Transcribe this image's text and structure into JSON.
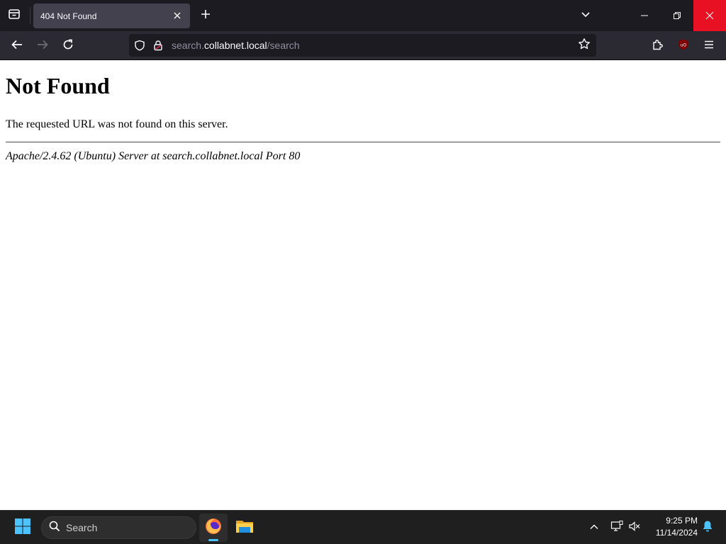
{
  "browser": {
    "tab": {
      "title": "404 Not Found"
    },
    "url": {
      "prefix": "search.",
      "host": "collabnet.local",
      "path": "/search"
    },
    "icons": {
      "tab_list": "firefox-view-icon",
      "close_tab": "close-icon",
      "new_tab": "plus-icon",
      "list_tabs": "chevron-down-icon",
      "back": "back-arrow-icon",
      "forward": "forward-arrow-icon",
      "reload": "reload-icon",
      "tracking": "shield-icon",
      "lock": "lock-icon",
      "bookmark": "star-icon",
      "extensions": "puzzle-icon",
      "ublock": "ublock-origin-icon",
      "menu": "hamburger-menu-icon"
    },
    "colors": {
      "chrome_dark": "#1c1b22",
      "toolbar": "#2b2a33",
      "tab_active": "#42414d",
      "close_hover": "#e81123"
    }
  },
  "page": {
    "heading": "Not Found",
    "message": "The requested URL was not found on this server.",
    "server_signature": "Apache/2.4.62 (Ubuntu) Server at search.collabnet.local Port 80"
  },
  "taskbar": {
    "search_label": "Search",
    "apps": [
      "firefox-icon",
      "file-explorer-icon"
    ],
    "tray": [
      "chevron-up-icon",
      "network-icon",
      "volume-muted-icon",
      "notification-bell-icon"
    ],
    "time": "9:25 PM",
    "date": "11/14/2024",
    "colors": {
      "windows_blue": "#4cc2ff",
      "bell": "#4cc2ff"
    }
  }
}
